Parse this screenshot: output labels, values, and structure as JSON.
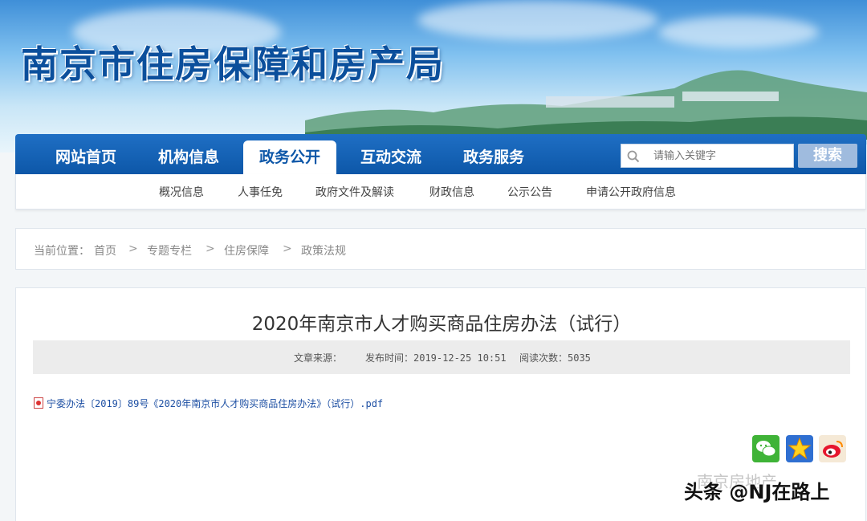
{
  "header": {
    "site_title": "南京市住房保障和房产局"
  },
  "nav": {
    "items": [
      {
        "label": "网站首页",
        "active": false
      },
      {
        "label": "机构信息",
        "active": false
      },
      {
        "label": "政务公开",
        "active": true
      },
      {
        "label": "互动交流",
        "active": false
      },
      {
        "label": "政务服务",
        "active": false
      }
    ],
    "search": {
      "placeholder": "请输入关键字",
      "button_label": "搜索",
      "icon": "search-icon"
    }
  },
  "subnav": {
    "items": [
      {
        "label": "概况信息"
      },
      {
        "label": "人事任免"
      },
      {
        "label": "政府文件及解读"
      },
      {
        "label": "财政信息"
      },
      {
        "label": "公示公告"
      },
      {
        "label": "申请公开政府信息"
      }
    ]
  },
  "breadcrumb": {
    "prefix": "当前位置：",
    "items": [
      {
        "label": "首页"
      },
      {
        "label": "专题专栏"
      },
      {
        "label": "住房保障"
      },
      {
        "label": "政策法规"
      }
    ],
    "separator": ">"
  },
  "article": {
    "title": "2020年南京市人才购买商品住房办法（试行）",
    "source_label": "文章来源：",
    "publish_time": "发布时间：2019-12-25 10:51",
    "read_count": "阅读次数：5035",
    "attachment": "宁委办法〔2019〕89号《2020年南京市人才购买商品住房办法》（试行）.pdf"
  },
  "share": {
    "icons": [
      "wechat-icon",
      "favorite-star-icon",
      "weibo-icon"
    ]
  },
  "watermark": {
    "text": "头条 @NJ在路上",
    "faint_text": "南京房地产"
  },
  "colors": {
    "nav_blue": "#0d57a8",
    "link_blue": "#1d4fa3",
    "search_button": "#9fbbde"
  }
}
